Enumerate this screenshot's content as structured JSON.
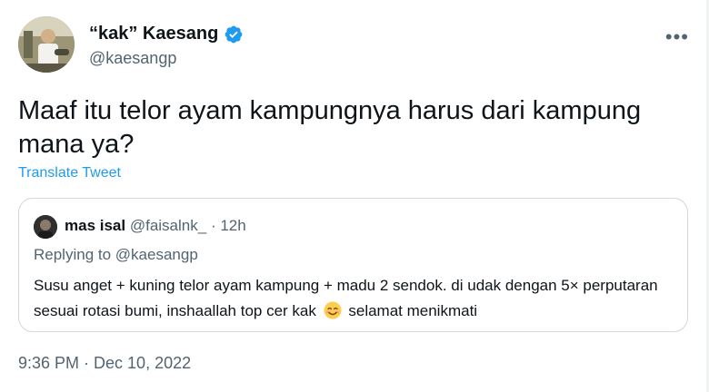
{
  "author": {
    "name": "“kak” Kaesang",
    "handle": "@kaesangp",
    "verified": true,
    "icon": "verified-badge-icon"
  },
  "tweet": {
    "text": "Maaf itu telor ayam kampungnya harus dari kampung mana ya?",
    "translate_label": "Translate Tweet",
    "timestamp": "9:36 PM · Dec 10, 2022"
  },
  "quoted_tweet": {
    "name": "mas isal",
    "handle": "@faisalnk_",
    "separator": "·",
    "age": "12h",
    "replying_to_label": "Replying to",
    "replying_to_handle": "@kaesangp",
    "text_before_emoji": "Susu anget + kuning telor ayam kampung + madu 2 sendok. di udak dengan 5× perputaran sesuai rotasi bumi, inshaallah top cer kak",
    "emoji": "smiling-face-emoji",
    "text_after_emoji": "selamat menikmati"
  },
  "more_menu_icon": "more-horizontal-icon",
  "colors": {
    "link": "#1d9bf0",
    "secondary_text": "#536471",
    "primary_text": "#0f1419",
    "border": "#cfd9de"
  }
}
